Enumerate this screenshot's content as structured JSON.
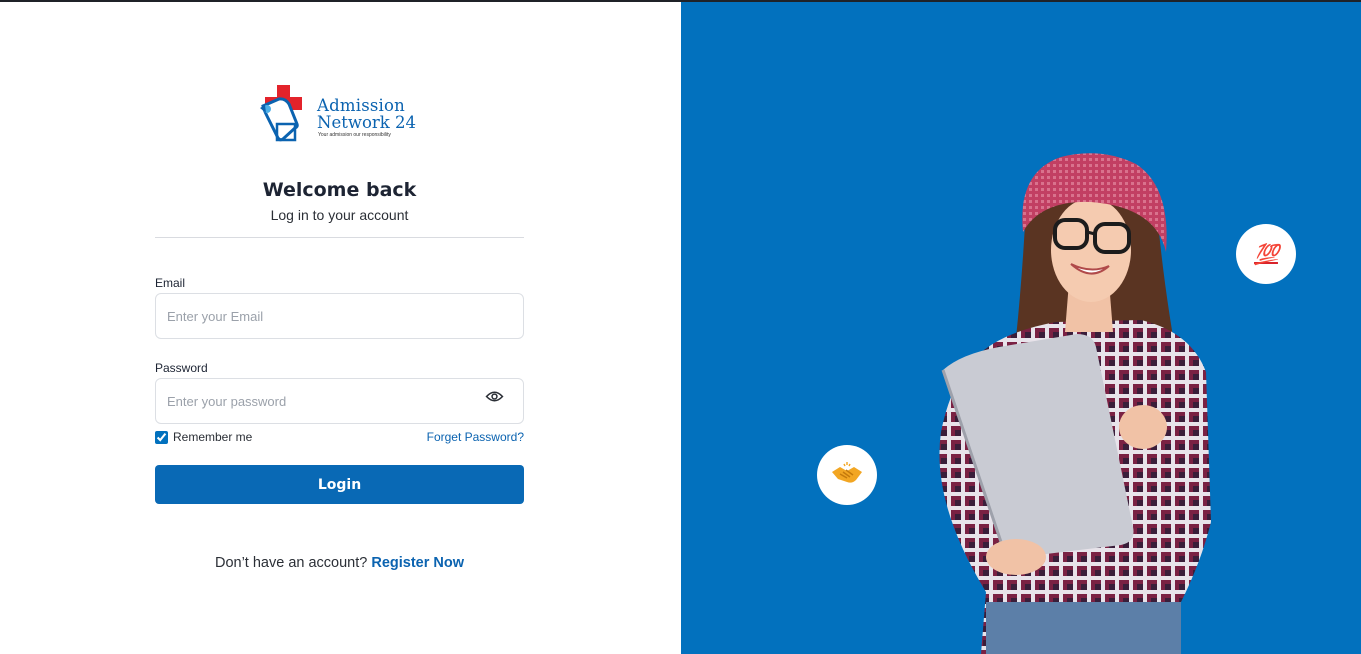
{
  "logo": {
    "line1": "Admission",
    "line2": "Network 24",
    "tagline": "Your admission our responsibility"
  },
  "header": {
    "title": "Welcome back",
    "subtitle": "Log in to your account"
  },
  "form": {
    "email_label": "Email",
    "email_placeholder": "Enter your Email",
    "email_value": "",
    "password_label": "Password",
    "password_placeholder": "Enter your password",
    "password_value": "",
    "remember_label": "Remember me",
    "remember_checked": true,
    "forgot_label": "Forget Password?",
    "login_label": "Login"
  },
  "footer": {
    "prompt": "Don’t have an account?",
    "register_label": "Register Now"
  },
  "hero": {
    "badge_top": "💯",
    "badge_bottom_icon": "handshake-icon"
  },
  "colors": {
    "brand_blue": "#0271be",
    "button_blue": "#0969b5",
    "logo_red": "#e3232b"
  }
}
